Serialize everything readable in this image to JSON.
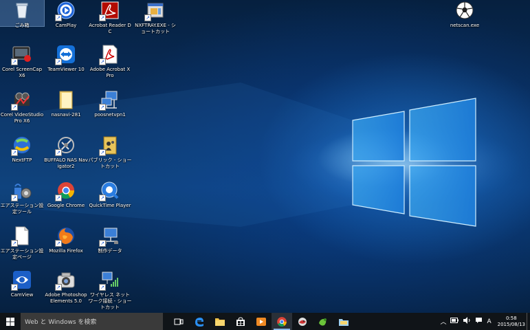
{
  "desktop": {
    "icons": [
      {
        "label": "ごみ箱",
        "icon": "recycle-bin-icon"
      },
      {
        "label": "CamPlay",
        "icon": "camplay-icon"
      },
      {
        "label": "Acrobat Reader DC",
        "icon": "acrobat-reader-icon"
      },
      {
        "label": "NXFTRAY.EXE - ショートカット",
        "icon": "nxftray-icon"
      },
      {
        "label": "netscan.exe",
        "icon": "netscan-icon"
      },
      {
        "label": "Corel ScreenCap X6",
        "icon": "corel-screencap-icon"
      },
      {
        "label": "TeamViewer 10",
        "icon": "teamviewer-icon"
      },
      {
        "label": "Adobe Acrobat X Pro",
        "icon": "adobe-acrobat-icon"
      },
      {
        "label": "Corel VideoStudio Pro X6",
        "icon": "corel-videostudio-icon"
      },
      {
        "label": "nasnavi-281",
        "icon": "folder-icon"
      },
      {
        "label": "poosnetvpn1",
        "icon": "network-icon"
      },
      {
        "label": "NextFTP",
        "icon": "nextftp-icon"
      },
      {
        "label": "BUFFALO NAS Navigator2",
        "icon": "nas-navigator-icon"
      },
      {
        "label": "パブリック - ショートカット",
        "icon": "public-folder-icon"
      },
      {
        "label": "エアステーション設定ツール",
        "icon": "airstation-tool-icon"
      },
      {
        "label": "Google Chrome",
        "icon": "chrome-icon"
      },
      {
        "label": "QuickTime Player",
        "icon": "quicktime-icon"
      },
      {
        "label": "エアステーション設定ページ",
        "icon": "document-icon"
      },
      {
        "label": "Mozilla Firefox",
        "icon": "firefox-icon"
      },
      {
        "label": "制作データ",
        "icon": "network-icon"
      },
      {
        "label": "CamView",
        "icon": "camview-icon"
      },
      {
        "label": "Adobe Photoshop Elements 5.0",
        "icon": "photoshop-elements-icon"
      },
      {
        "label": "ワイヤレス ネットワーク接続 - ショートカット",
        "icon": "wireless-network-icon"
      }
    ]
  },
  "taskbar": {
    "search_placeholder": "Web と Windows を検索",
    "buttons": [
      "task-view",
      "edge",
      "file-explorer",
      "store",
      "media-player",
      "chrome",
      "app-bird",
      "app-green",
      "app-folder"
    ],
    "tray": {
      "ime": "A",
      "time": "0:58",
      "date": "2015/08/13"
    }
  },
  "colors": {
    "taskbar": "#101418",
    "accent": "#8ab8e8"
  }
}
